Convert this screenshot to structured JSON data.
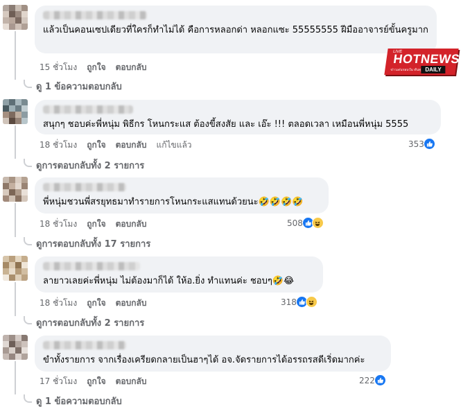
{
  "comments": [
    {
      "text": "แล้วเป็นคอนเซปเดียวที่ใครก็ทำไม่ได้ คือการหลอกด่า หลอกแซะ 55555555 ฝีมืออาจารย์ขั้นครูมาก",
      "time": "15 ชั่วโมง",
      "like": "ถูกใจ",
      "reply": "ตอบกลับ",
      "edited": "",
      "reaction_count": "",
      "replies_label": "ดู 1 ข้อความตอบกลับ"
    },
    {
      "text": "สนุกๆ ชอบค่ะพี่หนุ่ม พิธีกร โหนกระแส ต้องขี้สงสัย และ เอ๊ะ !!! ตลอดเวลา เหมือนพี่หนุ่ม 5555",
      "time": "18 ชั่วโมง",
      "like": "ถูกใจ",
      "reply": "ตอบกลับ",
      "edited": "แก้ไขแล้ว",
      "reaction_count": "353",
      "replies_label": "ดูการตอบกลับทั้ง 2 รายการ"
    },
    {
      "text": "พี่หนุ่มชวนพี่สรยุทธมาทำรายการโหนกระแสแทนด้วยนะ🤣🤣🤣🤣",
      "time": "18 ชั่วโมง",
      "like": "ถูกใจ",
      "reply": "ตอบกลับ",
      "edited": "",
      "reaction_count": "508",
      "replies_label": "ดูการตอบกลับทั้ง 17 รายการ"
    },
    {
      "text": "ลายาวเลยค่ะพี่หนุ่ม ไม่ต้องมาก็ได้ ให้อ.ยิ่ง ทำแทนค่ะ ชอบๆ🤣😂",
      "time": "18 ชั่วโมง",
      "like": "ถูกใจ",
      "reply": "ตอบกลับ",
      "edited": "",
      "reaction_count": "318",
      "replies_label": "ดูการตอบกลับทั้ง 2 รายการ"
    },
    {
      "text": "ขำทั้งรายการ จากเรื่องเครียดกลายเป็นฮาๆได้ อจ.จัดรายการได้อรรถรสดีเริ่ดมากค่ะ",
      "time": "17 ชั่วโมง",
      "like": "ถูกใจ",
      "reply": "ตอบกลับ",
      "edited": "",
      "reaction_count": "222",
      "replies_label": "ดู 1 ข้อความตอบกลับ"
    }
  ],
  "watermark": {
    "top": "LIVE",
    "name": "HOTNEWS",
    "tagline": "ข่าวเด่นรอบวัน ทันทุกกระแส",
    "daily": "DAILY"
  },
  "colors": {
    "bubble": "#f0f2f5",
    "meta": "#65676b",
    "like_blue": "#1877f2",
    "laugh_yellow": "#f7c94a",
    "brand_red": "#d3232a"
  }
}
